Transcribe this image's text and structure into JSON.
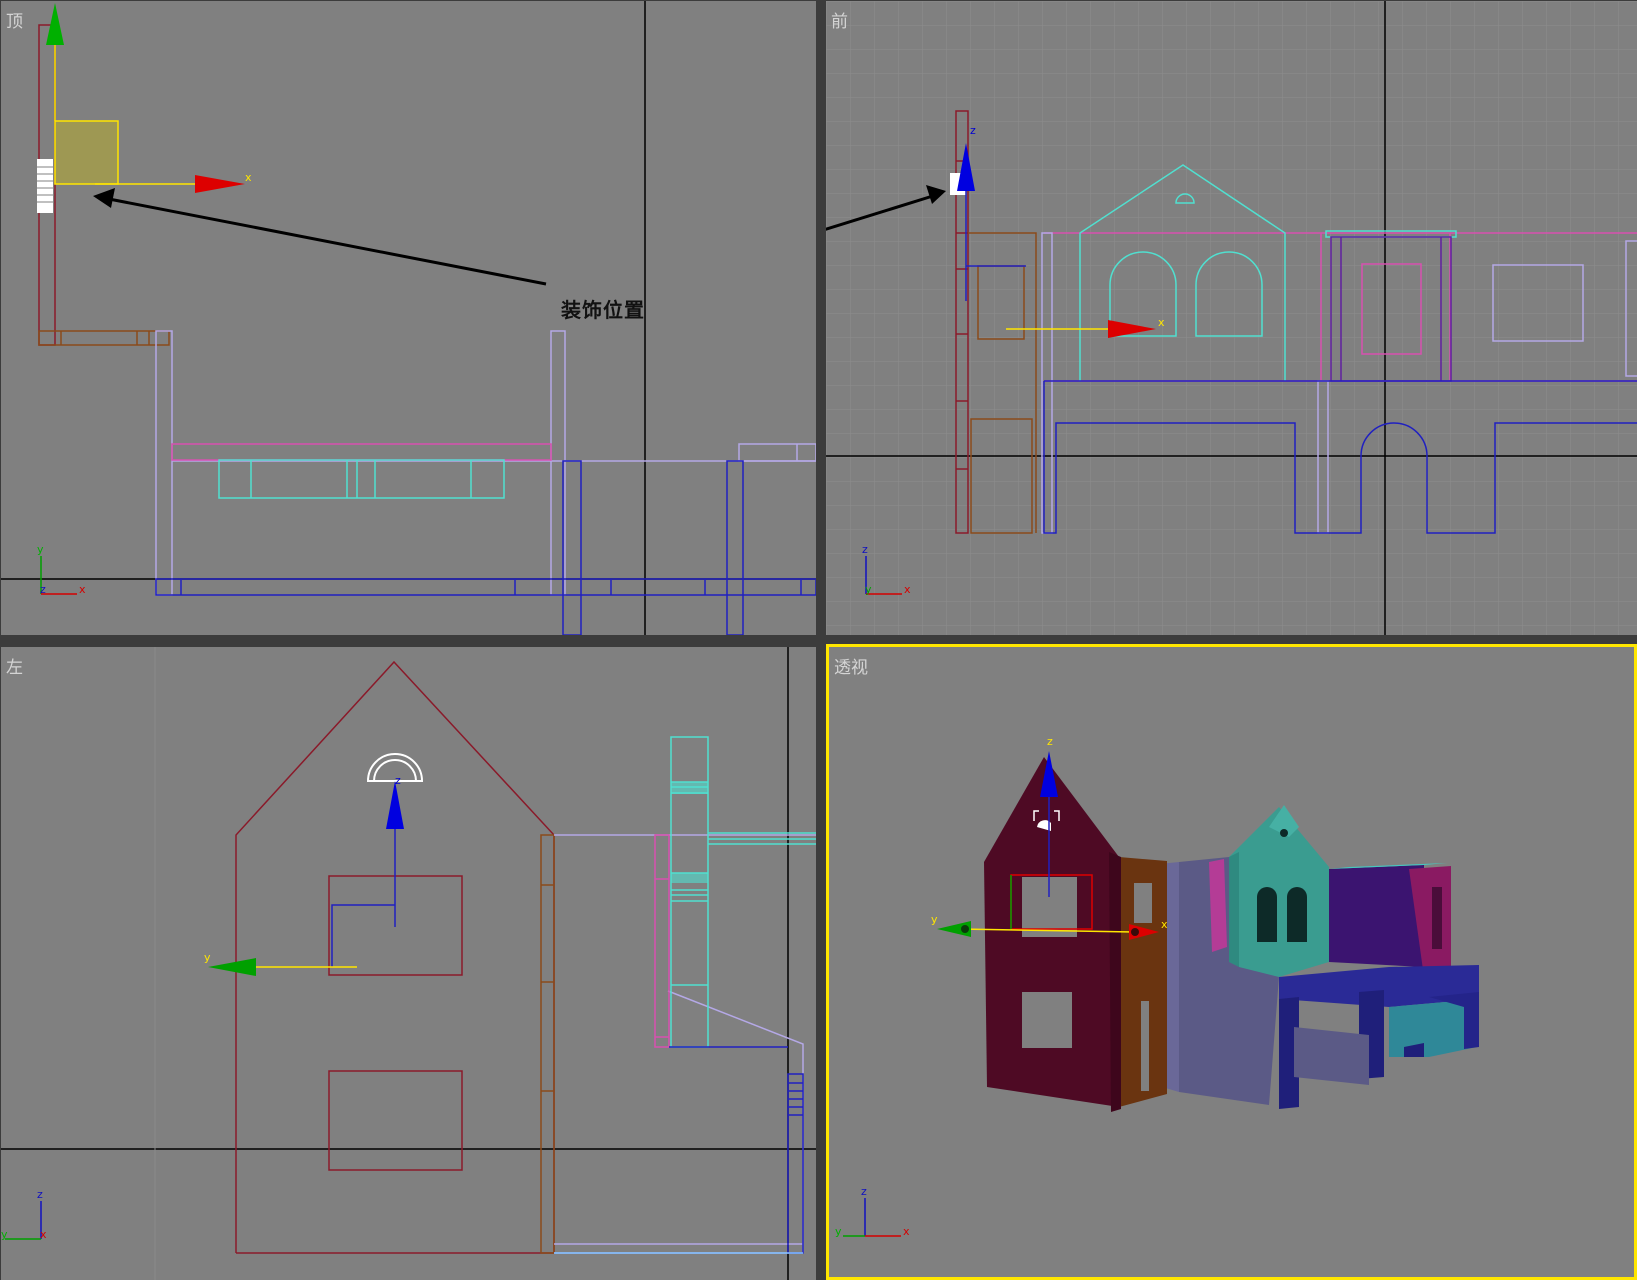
{
  "viewports": {
    "top": {
      "label": "顶"
    },
    "front": {
      "label": "前"
    },
    "left": {
      "label": "左"
    },
    "persp": {
      "label": "透视",
      "active": true
    }
  },
  "annotation": {
    "text": "装饰位置"
  },
  "axis_letters": {
    "x": "x",
    "y": "y",
    "z": "z"
  },
  "colors": {
    "viewport_bg": "#808080",
    "grid": "#8c8c8c",
    "active_border": "#ffe600",
    "axis_x": "#d40000",
    "axis_y": "#00a000",
    "axis_z": "#0000d0",
    "gizmo_line": "#ffe600"
  }
}
